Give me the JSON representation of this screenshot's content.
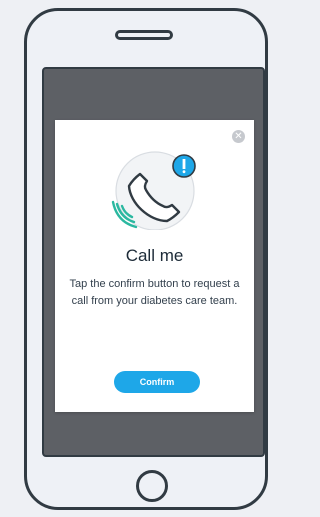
{
  "modal": {
    "close_icon": "close-icon",
    "illustration_icon": "phone-call-icon",
    "badge_icon": "alert-badge-icon",
    "title": "Call me",
    "message": "Tap the confirm button to request a call from your diabetes care team.",
    "confirm_label": "Confirm"
  },
  "colors": {
    "accent": "#1ea7e8",
    "wave": "#2bb8a0",
    "overlay": "#5d6065",
    "frame": "#313b43"
  }
}
